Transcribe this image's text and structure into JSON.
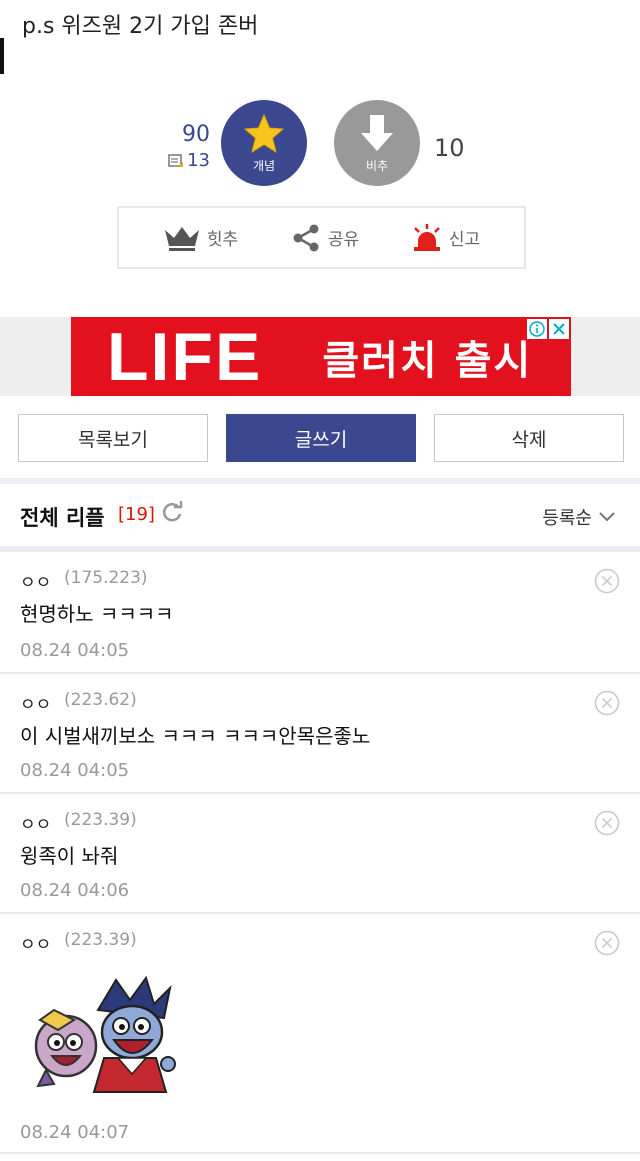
{
  "post": {
    "text": "p.s 위즈원 2기 가입 존버"
  },
  "vote": {
    "up_count": "90",
    "memo_count": "13",
    "up_label": "개념",
    "down_label": "비추",
    "down_count": "10"
  },
  "actions": [
    {
      "label": "힛추",
      "icon": "crown-icon"
    },
    {
      "label": "공유",
      "icon": "share-icon"
    },
    {
      "label": "신고",
      "icon": "siren-icon"
    }
  ],
  "ad": {
    "logo": "LIFE",
    "text": "클러치 출시",
    "info_icon": "info-icon",
    "close_icon": "close-icon"
  },
  "buttons": {
    "list": "목록보기",
    "write": "글쓰기",
    "delete": "삭제"
  },
  "comments_header": {
    "title": "전체 리플",
    "count": "[19]",
    "sort": "등록순"
  },
  "comments": [
    {
      "nick": "ㅇㅇ",
      "ip": "(175.223)",
      "body": "현명하노 ㅋㅋㅋㅋ",
      "date": "08.24 04:05"
    },
    {
      "nick": "ㅇㅇ",
      "ip": "(223.62)",
      "body": "이 시벌새끼보소 ㅋㅋㅋ ㅋㅋㅋ안목은좋노",
      "date": "08.24 04:05"
    },
    {
      "nick": "ㅇㅇ",
      "ip": "(223.39)",
      "body": "윙족이 놔줘",
      "date": "08.24 04:06"
    },
    {
      "nick": "ㅇㅇ",
      "ip": "(223.39)",
      "body": "",
      "date": "08.24 04:07",
      "sticker": "cartoon-sticker"
    }
  ],
  "colors": {
    "brand": "#3b4890",
    "ad_red": "#e3101e",
    "count_red": "#d31900"
  }
}
